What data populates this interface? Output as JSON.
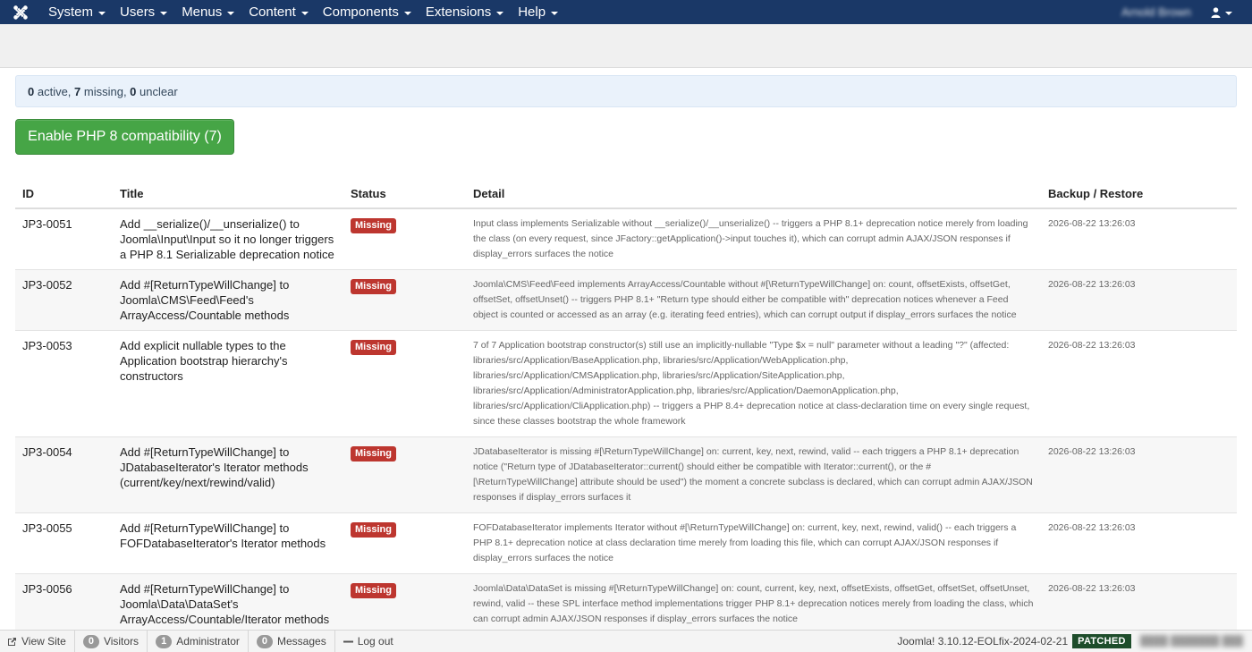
{
  "navbar": {
    "menus": [
      {
        "label": "System"
      },
      {
        "label": "Users"
      },
      {
        "label": "Menus"
      },
      {
        "label": "Content"
      },
      {
        "label": "Components"
      },
      {
        "label": "Extensions"
      },
      {
        "label": "Help"
      }
    ],
    "username": "Arnold Brown"
  },
  "summary": {
    "active": "0",
    "active_label": " active, ",
    "missing": "7",
    "missing_label": " missing, ",
    "unclear": "0",
    "unclear_label": " unclear"
  },
  "enable_button": "Enable PHP 8 compatibility (7)",
  "table": {
    "headers": {
      "id": "ID",
      "title": "Title",
      "status": "Status",
      "detail": "Detail",
      "backup": "Backup / Restore"
    },
    "rows": [
      {
        "id": "JP3-0051",
        "title": "Add __serialize()/__unserialize() to Joomla\\Input\\Input so it no longer triggers a PHP 8.1 Serializable deprecation notice",
        "status": "Missing",
        "detail": "Input class implements Serializable without __serialize()/__unserialize() -- triggers a PHP 8.1+ deprecation notice merely from loading the class (on every request, since JFactory::getApplication()->input touches it), which can corrupt admin AJAX/JSON responses if display_errors surfaces the notice",
        "backup": "2026-08-22 13:26:03"
      },
      {
        "id": "JP3-0052",
        "title": "Add #[ReturnTypeWillChange] to Joomla\\CMS\\Feed\\Feed's ArrayAccess/Countable methods",
        "status": "Missing",
        "detail": "Joomla\\CMS\\Feed\\Feed implements ArrayAccess/Countable without #[\\ReturnTypeWillChange] on: count, offsetExists, offsetGet, offsetSet, offsetUnset() -- triggers PHP 8.1+ \"Return type should either be compatible with\" deprecation notices whenever a Feed object is counted or accessed as an array (e.g. iterating feed entries), which can corrupt output if display_errors surfaces the notice",
        "backup": "2026-08-22 13:26:03"
      },
      {
        "id": "JP3-0053",
        "title": "Add explicit nullable types to the Application bootstrap hierarchy's constructors",
        "status": "Missing",
        "detail": "7 of 7 Application bootstrap constructor(s) still use an implicitly-nullable \"Type $x = null\" parameter without a leading \"?\" (affected: libraries/src/Application/BaseApplication.php, libraries/src/Application/WebApplication.php, libraries/src/Application/CMSApplication.php, libraries/src/Application/SiteApplication.php, libraries/src/Application/AdministratorApplication.php, libraries/src/Application/DaemonApplication.php, libraries/src/Application/CliApplication.php) -- triggers a PHP 8.4+ deprecation notice at class-declaration time on every single request, since these classes bootstrap the whole framework",
        "backup": "2026-08-22 13:26:03"
      },
      {
        "id": "JP3-0054",
        "title": "Add #[ReturnTypeWillChange] to JDatabaseIterator's Iterator methods (current/key/next/rewind/valid)",
        "status": "Missing",
        "detail": "JDatabaseIterator is missing #[\\ReturnTypeWillChange] on: current, key, next, rewind, valid -- each triggers a PHP 8.1+ deprecation notice (\"Return type of JDatabaseIterator::current() should either be compatible with Iterator::current(), or the #[\\ReturnTypeWillChange] attribute should be used\") the moment a concrete subclass is declared, which can corrupt admin AJAX/JSON responses if display_errors surfaces it",
        "backup": "2026-08-22 13:26:03"
      },
      {
        "id": "JP3-0055",
        "title": "Add #[ReturnTypeWillChange] to FOFDatabaseIterator's Iterator methods",
        "status": "Missing",
        "detail": "FOFDatabaseIterator implements Iterator without #[\\ReturnTypeWillChange] on: current, key, next, rewind, valid() -- each triggers a PHP 8.1+ deprecation notice at class declaration time merely from loading this file, which can corrupt AJAX/JSON responses if display_errors surfaces the notice",
        "backup": "2026-08-22 13:26:03"
      },
      {
        "id": "JP3-0056",
        "title": "Add #[ReturnTypeWillChange] to Joomla\\Data\\DataSet's ArrayAccess/Countable/Iterator methods",
        "status": "Missing",
        "detail": "Joomla\\Data\\DataSet is missing #[\\ReturnTypeWillChange] on: count, current, key, next, offsetExists, offsetGet, offsetSet, offsetUnset, rewind, valid -- these SPL interface method implementations trigger PHP 8.1+ deprecation notices merely from loading the class, which can corrupt admin AJAX/JSON responses if display_errors surfaces the notice",
        "backup": "2026-08-22 13:26:03"
      }
    ]
  },
  "statusbar": {
    "view_site": "View Site",
    "visitors_count": "0",
    "visitors_label": "Visitors",
    "admin_count": "1",
    "admin_label": "Administrator",
    "messages_count": "0",
    "messages_label": "Messages",
    "logout": "Log out",
    "version": "Joomla! 3.10.12-EOLfix-2024-02-21",
    "patched": "PATCHED"
  }
}
